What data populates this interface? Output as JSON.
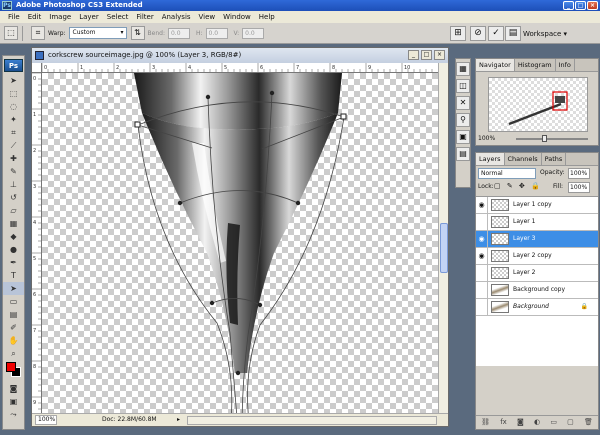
{
  "app": {
    "title": "Adobe Photoshop CS3 Extended",
    "logo": "Ps"
  },
  "menu": [
    "File",
    "Edit",
    "Image",
    "Layer",
    "Select",
    "Filter",
    "Analysis",
    "View",
    "Window",
    "Help"
  ],
  "options": {
    "warp_label": "Warp:",
    "warp_value": "Custom",
    "bend_label": "Bend:",
    "bend_value": "0.0",
    "h_label": "H:",
    "h_value": "0.0",
    "v_label": "V:",
    "v_value": "0.0",
    "workspace_label": "Workspace ▾"
  },
  "tools": {
    "badge": "Ps"
  },
  "document": {
    "title": "corkscrew sourceimage.jpg @ 100% (Layer 3, RGB/8#)",
    "zoom": "100%",
    "doc_info": "Doc: 22.8M/60.8M"
  },
  "navigator": {
    "tabs": [
      "Navigator",
      "Histogram",
      "Info"
    ],
    "zoom": "100%"
  },
  "layers": {
    "tabs": [
      "Layers",
      "Channels",
      "Paths"
    ],
    "blend_mode": "Normal",
    "opacity_label": "Opacity:",
    "opacity_value": "100%",
    "lock_label": "Lock:",
    "fill_label": "Fill:",
    "fill_value": "100%",
    "items": [
      {
        "name": "Layer 1 copy",
        "visible": true
      },
      {
        "name": "Layer 1",
        "visible": false
      },
      {
        "name": "Layer 3",
        "visible": true,
        "active": true
      },
      {
        "name": "Layer 2 copy",
        "visible": true
      },
      {
        "name": "Layer 2",
        "visible": false
      },
      {
        "name": "Background copy",
        "visible": false
      },
      {
        "name": "Background",
        "visible": false
      }
    ]
  },
  "colors": {
    "foreground": "#f00000",
    "background": "#000000",
    "layer_selected": "#3d8ee6"
  },
  "ruler_marks": [
    "0",
    "1",
    "2",
    "3",
    "4",
    "5",
    "6",
    "7",
    "8",
    "9",
    "10"
  ]
}
